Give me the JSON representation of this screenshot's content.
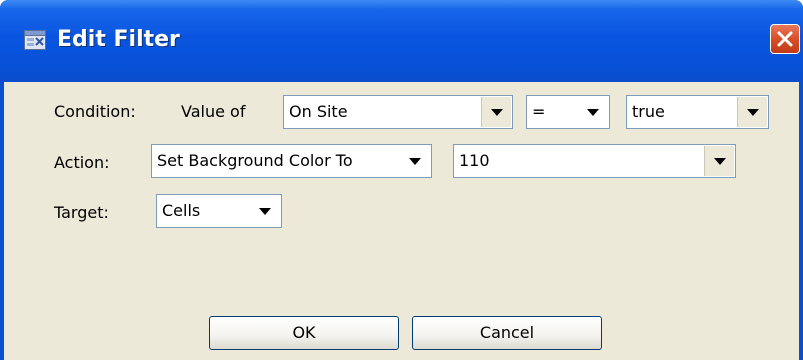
{
  "window": {
    "title": "Edit Filter",
    "app_icon": "filter-app-icon",
    "close_icon": "close-icon"
  },
  "condition": {
    "label": "Condition:",
    "value_of_label": "Value of",
    "field": "On Site",
    "operator": "=",
    "value": "true"
  },
  "action": {
    "label": "Action:",
    "type": "Set Background Color To",
    "color_value": "110"
  },
  "target": {
    "label": "Target:",
    "value": "Cells"
  },
  "buttons": {
    "ok": "OK",
    "cancel": "Cancel"
  },
  "colors": {
    "titlebar": "#0a55e0",
    "dialog_background": "#ece9d8",
    "close_button": "#d94e28",
    "field_border": "#7f9db9"
  }
}
